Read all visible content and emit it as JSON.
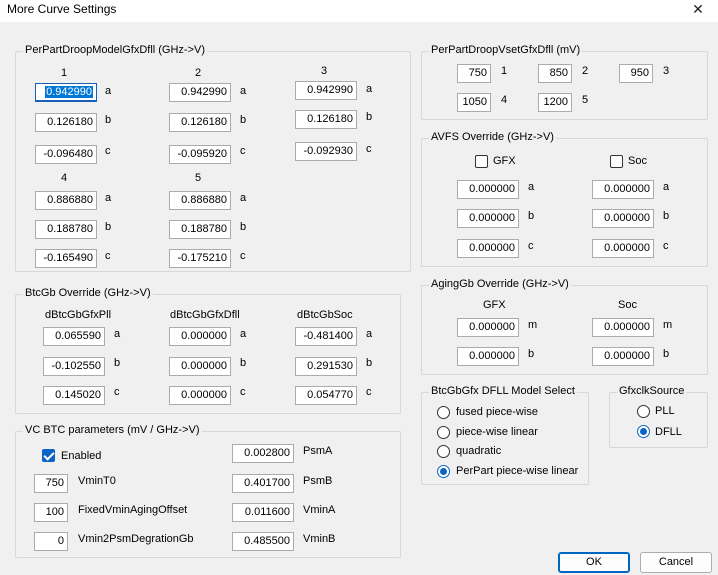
{
  "window": {
    "title": "More Curve Settings",
    "close_glyph": "✕"
  },
  "droop_model": {
    "legend": "PerPartDroopModelGfxDfll (GHz->V)",
    "coef_labels": [
      "a",
      "b",
      "c"
    ],
    "columns": [
      {
        "header": "1",
        "a": "0.942990",
        "b": "0.126180",
        "c": "-0.096480"
      },
      {
        "header": "2",
        "a": "0.942990",
        "b": "0.126180",
        "c": "-0.095920"
      },
      {
        "header": "3",
        "a": "0.942990",
        "b": "0.126180",
        "c": "-0.092930"
      },
      {
        "header": "4",
        "a": "0.886880",
        "b": "0.188780",
        "c": "-0.165490"
      },
      {
        "header": "5",
        "a": "0.886880",
        "b": "0.188780",
        "c": "-0.175210"
      }
    ]
  },
  "droop_vset": {
    "legend": "PerPartDroopVsetGfxDfll (mV)",
    "items": [
      {
        "value": "750",
        "label": "1"
      },
      {
        "value": "850",
        "label": "2"
      },
      {
        "value": "950",
        "label": "3"
      },
      {
        "value": "1050",
        "label": "4"
      },
      {
        "value": "1200",
        "label": "5"
      }
    ]
  },
  "avfs": {
    "legend": "AVFS Override (GHz->V)",
    "gfx": {
      "label": "GFX",
      "checked": false,
      "a": "0.000000",
      "b": "0.000000",
      "c": "0.000000"
    },
    "soc": {
      "label": "Soc",
      "checked": false,
      "a": "0.000000",
      "b": "0.000000",
      "c": "0.000000"
    },
    "coef_labels": [
      "a",
      "b",
      "c"
    ]
  },
  "btcgb": {
    "legend": "BtcGb Override (GHz->V)",
    "coef_labels": [
      "a",
      "b",
      "c"
    ],
    "columns": [
      {
        "header": "dBtcGbGfxPll",
        "a": "0.065590",
        "b": "-0.102550",
        "c": "0.145020"
      },
      {
        "header": "dBtcGbGfxDfll",
        "a": "0.000000",
        "b": "0.000000",
        "c": "0.000000"
      },
      {
        "header": "dBtcGbSoc",
        "a": "-0.481400",
        "b": "0.291530",
        "c": "0.054770"
      }
    ]
  },
  "aginggb": {
    "legend": "AgingGb Override (GHz->V)",
    "gfx": {
      "header": "GFX",
      "m": "0.000000",
      "b": "0.000000"
    },
    "soc": {
      "header": "Soc",
      "m": "0.000000",
      "b": "0.000000"
    },
    "coef_labels": [
      "m",
      "b"
    ]
  },
  "vc_btc": {
    "legend": "VC BTC parameters (mV / GHz->V)",
    "enabled": {
      "label": "Enabled",
      "checked": true
    },
    "left": [
      {
        "value": "750",
        "label": "VminT0"
      },
      {
        "value": "100",
        "label": "FixedVminAgingOffset"
      },
      {
        "value": "0",
        "label": "Vmin2PsmDegrationGb"
      }
    ],
    "right": [
      {
        "value": "0.002800",
        "label": "PsmA"
      },
      {
        "value": "0.401700",
        "label": "PsmB"
      },
      {
        "value": "0.011600",
        "label": "VminA"
      },
      {
        "value": "0.485500",
        "label": "VminB"
      }
    ]
  },
  "dfll_model": {
    "legend": "BtcGbGfx DFLL Model Select",
    "options": [
      {
        "label": "fused piece-wise",
        "selected": false
      },
      {
        "label": "piece-wise linear",
        "selected": false
      },
      {
        "label": "quadratic",
        "selected": false
      },
      {
        "label": "PerPart piece-wise linear",
        "selected": true
      }
    ]
  },
  "gfxclk": {
    "legend": "GfxclkSource",
    "options": [
      {
        "label": "PLL",
        "selected": false
      },
      {
        "label": "DFLL",
        "selected": true
      }
    ]
  },
  "buttons": {
    "ok": "OK",
    "cancel": "Cancel"
  }
}
